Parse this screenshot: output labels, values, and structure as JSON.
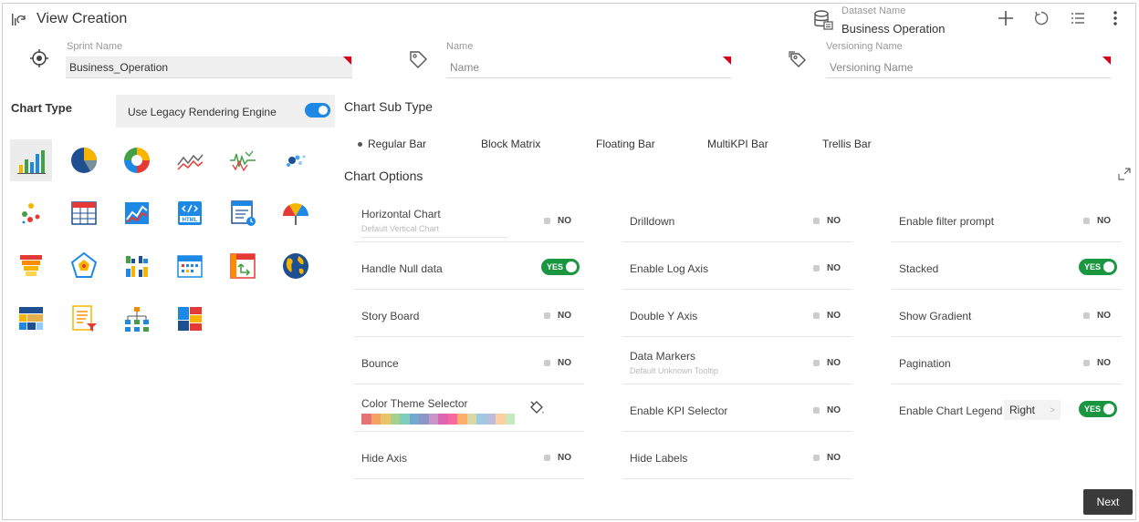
{
  "header": {
    "title": "View Creation",
    "dataset_label": "Dataset Name",
    "dataset_value": "Business Operation"
  },
  "fields": {
    "sprint": {
      "label": "Sprint Name",
      "value": "Business_Operation"
    },
    "name": {
      "label": "Name",
      "placeholder": "Name"
    },
    "versioning": {
      "label": "Versioning Name",
      "placeholder": "Versioning Name"
    }
  },
  "chart_type": {
    "label": "Chart Type",
    "legacy_label": "Use Legacy Rendering Engine",
    "icons": [
      "bar-chart-icon",
      "pie-chart-icon",
      "donut-chart-icon",
      "line-chart-icon",
      "timeseries-chart-icon",
      "scatter-chart-icon",
      "bubble-chart-icon",
      "table-grid-icon",
      "combo-chart-icon",
      "html-icon",
      "card-icon",
      "gauge-icon",
      "funnel-icon",
      "radar-icon",
      "matrix-chart-icon",
      "calendar-icon",
      "pivot-icon",
      "map-globe-icon",
      "heatmap-icon",
      "filtered-list-icon",
      "tree-icon",
      "treemap-icon"
    ]
  },
  "sub_type": {
    "label": "Chart Sub Type",
    "items": [
      "Regular Bar",
      "Block Matrix",
      "Floating Bar",
      "MultiKPI Bar",
      "Trellis Bar"
    ]
  },
  "options": {
    "label": "Chart Options",
    "horizontal_chart": "Horizontal Chart",
    "horizontal_sub": "Default Vertical Chart",
    "drilldown": "Drilldown",
    "enable_filter_prompt": "Enable filter prompt",
    "handle_null": "Handle Null data",
    "enable_log_axis": "Enable Log Axis",
    "stacked": "Stacked",
    "story_board": "Story Board",
    "double_y_axis": "Double Y Axis",
    "show_gradient": "Show Gradient",
    "bounce": "Bounce",
    "data_markers": "Data Markers",
    "data_markers_sub": "Default Unknown Tooltip",
    "pagination": "Pagination",
    "color_theme": "Color Theme Selector",
    "enable_kpi_selector": "Enable KPI Selector",
    "enable_chart_legend": "Enable Chart Legend",
    "legend_position": "Right",
    "hide_axis": "Hide Axis",
    "hide_labels": "Hide Labels",
    "no": "NO",
    "yes": "YES"
  },
  "theme_colors": [
    "#e57373",
    "#f4a261",
    "#e9c46a",
    "#a8d08d",
    "#7fcdbb",
    "#74a9cf",
    "#8c96c6",
    "#c994c7",
    "#df65b0",
    "#f768a1",
    "#fdae6b",
    "#d9d9a6",
    "#9ecae1",
    "#bcbddc",
    "#fdd0a2",
    "#c7e9c0"
  ],
  "next_label": "Next"
}
